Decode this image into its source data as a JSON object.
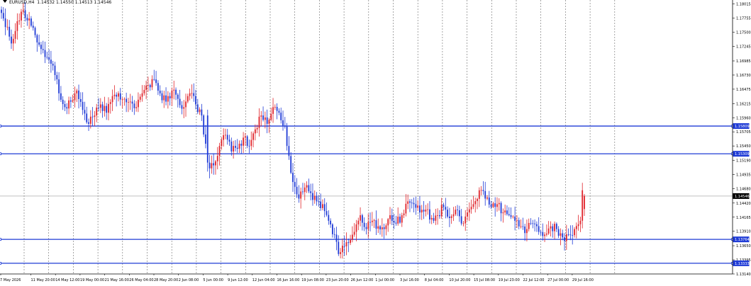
{
  "header": {
    "symbol": "EURUSD,H4",
    "ohlc": "1.14532 1.14550 1.14513 1.14546"
  },
  "colors": {
    "bull": "#e0242b",
    "bear": "#1f3bd6",
    "hline": "#1f3bd6",
    "grid": "#6b6b6b",
    "current": "#9a9a9a",
    "label_bg": "#1f3bd6"
  },
  "chart_data": {
    "type": "candlestick",
    "timeframe": "H4",
    "ylim": [
      1.1314,
      1.1802
    ],
    "y_ticks": [
      "1.18015",
      "1.17755",
      "1.17500",
      "1.17245",
      "1.16985",
      "1.16730",
      "1.16475",
      "1.16215",
      "1.15960",
      "1.15705",
      "1.15450",
      "1.15190",
      "1.14935",
      "1.14680",
      "1.14420",
      "1.14165",
      "1.13910",
      "1.13650",
      "1.13395",
      "1.13140"
    ],
    "x_ticks": [
      "7 May 2026",
      "11 May 20:00",
      "14 May 12:00",
      "19 May 00:00",
      "21 May 16:00",
      "26 May 04:00",
      "28 May 20:00",
      "2 Jun 08:00",
      "5 Jun 00:00",
      "9 Jun 12:00",
      "12 Jun 04:00",
      "16 Jun 16:00",
      "19 Jun 08:00",
      "23 Jun 20:00",
      "26 Jun 12:00",
      "1 Jul 00:00",
      "3 Jul 16:00",
      "8 Jul 04:00",
      "10 Jul 20:00",
      "15 Jul 08:00",
      "19 Jul 23:00",
      "22 Jul 12:00",
      "27 Jul 00:00",
      "29 Jul 16:00"
    ],
    "horizontal_lines": [
      {
        "label": "1.15809",
        "value": 1.15809
      },
      {
        "label": "1.15309",
        "value": 1.15309
      },
      {
        "label": "1.13764",
        "value": 1.13764
      },
      {
        "label": "1.13333",
        "value": 1.13333
      }
    ],
    "current_price": {
      "label": "1.14546",
      "value": 1.14546
    },
    "anchors": [
      [
        0,
        1.1785
      ],
      [
        3,
        1.176
      ],
      [
        5,
        1.173
      ],
      [
        8,
        1.177
      ],
      [
        11,
        1.179
      ],
      [
        14,
        1.1775
      ],
      [
        17,
        1.1745
      ],
      [
        20,
        1.172
      ],
      [
        23,
        1.1705
      ],
      [
        26,
        1.169
      ],
      [
        29,
        1.164
      ],
      [
        32,
        1.1615
      ],
      [
        35,
        1.1625
      ],
      [
        38,
        1.1645
      ],
      [
        41,
        1.161
      ],
      [
        44,
        1.1585
      ],
      [
        47,
        1.16
      ],
      [
        50,
        1.162
      ],
      [
        53,
        1.1605
      ],
      [
        56,
        1.1635
      ],
      [
        59,
        1.164
      ],
      [
        62,
        1.163
      ],
      [
        65,
        1.1625
      ],
      [
        68,
        1.1615
      ],
      [
        71,
        1.164
      ],
      [
        74,
        1.1655
      ],
      [
        77,
        1.1665
      ],
      [
        80,
        1.164
      ],
      [
        83,
        1.1625
      ],
      [
        86,
        1.1645
      ],
      [
        89,
        1.163
      ],
      [
        92,
        1.1615
      ],
      [
        95,
        1.164
      ],
      [
        98,
        1.162
      ],
      [
        101,
        1.16
      ],
      [
        104,
        1.1515
      ],
      [
        107,
        1.151
      ],
      [
        110,
        1.1545
      ],
      [
        113,
        1.1565
      ],
      [
        116,
        1.1535
      ],
      [
        119,
        1.154
      ],
      [
        122,
        1.156
      ],
      [
        125,
        1.1545
      ],
      [
        128,
        1.1575
      ],
      [
        131,
        1.16
      ],
      [
        134,
        1.1585
      ],
      [
        137,
        1.1615
      ],
      [
        140,
        1.1605
      ],
      [
        143,
        1.158
      ],
      [
        144,
        1.1545
      ],
      [
        147,
        1.148
      ],
      [
        150,
        1.145
      ],
      [
        153,
        1.147
      ],
      [
        156,
        1.146
      ],
      [
        159,
        1.1445
      ],
      [
        162,
        1.144
      ],
      [
        165,
        1.141
      ],
      [
        168,
        1.1385
      ],
      [
        170,
        1.135
      ],
      [
        172,
        1.1365
      ],
      [
        175,
        1.137
      ],
      [
        178,
        1.139
      ],
      [
        181,
        1.142
      ],
      [
        184,
        1.1395
      ],
      [
        187,
        1.141
      ],
      [
        190,
        1.14
      ],
      [
        193,
        1.1395
      ],
      [
        196,
        1.142
      ],
      [
        199,
        1.1405
      ],
      [
        202,
        1.142
      ],
      [
        205,
        1.1445
      ],
      [
        208,
        1.144
      ],
      [
        211,
        1.1425
      ],
      [
        214,
        1.143
      ],
      [
        217,
        1.1415
      ],
      [
        220,
        1.142
      ],
      [
        223,
        1.1435
      ],
      [
        226,
        1.1415
      ],
      [
        229,
        1.143
      ],
      [
        232,
        1.1405
      ],
      [
        235,
        1.1425
      ],
      [
        238,
        1.144
      ],
      [
        241,
        1.1465
      ],
      [
        244,
        1.145
      ],
      [
        247,
        1.1435
      ],
      [
        250,
        1.144
      ],
      [
        253,
        1.1425
      ],
      [
        256,
        1.142
      ],
      [
        259,
        1.141
      ],
      [
        262,
        1.14
      ],
      [
        265,
        1.1395
      ],
      [
        268,
        1.1405
      ],
      [
        271,
        1.139
      ],
      [
        274,
        1.1385
      ],
      [
        277,
        1.14
      ],
      [
        280,
        1.1395
      ],
      [
        283,
        1.138
      ],
      [
        286,
        1.1385
      ],
      [
        289,
        1.1395
      ],
      [
        292,
        1.141
      ],
      [
        294,
        1.1455
      ]
    ],
    "events": [
      {
        "i": 104,
        "type": "gap_down",
        "from": 1.16,
        "to": 1.1515
      },
      {
        "i": 144,
        "type": "gap_down",
        "from": 1.158,
        "to": 1.1545
      },
      {
        "i": 293,
        "type": "spike_up",
        "from": 1.141,
        "to": 1.1465
      }
    ]
  }
}
